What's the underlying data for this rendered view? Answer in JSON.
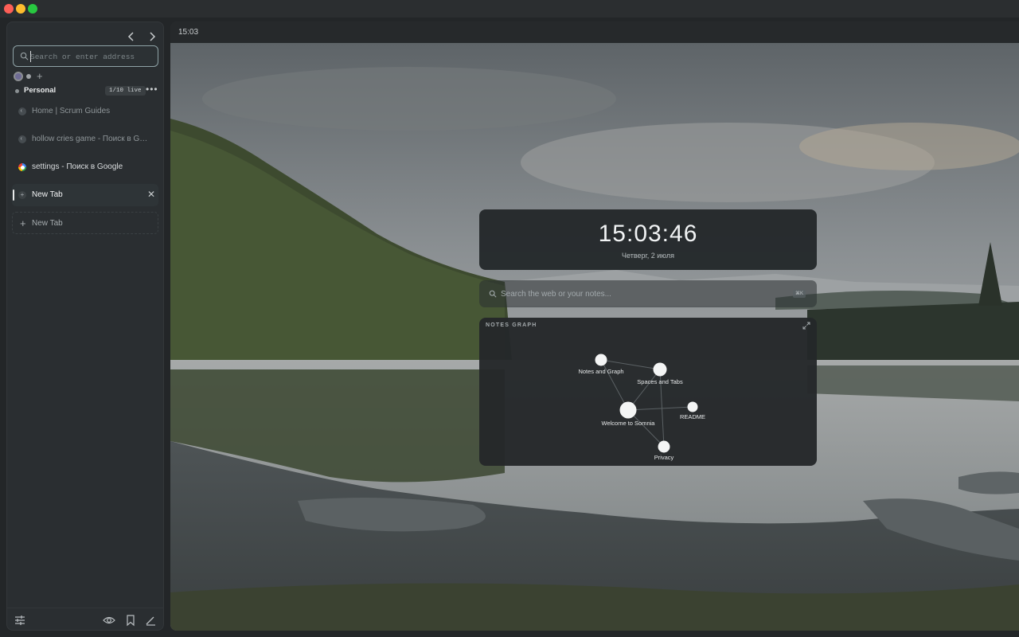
{
  "sidebar": {
    "url_placeholder": "Search or enter address",
    "space": {
      "name": "Personal",
      "badge": "1/10 live"
    },
    "tabs": [
      {
        "title": "Home | Scrum Guides",
        "favicon": "moon-icon"
      },
      {
        "title": "hollow cries game - Поиск в Google",
        "favicon": "moon-icon"
      },
      {
        "title": "settings - Поиск в Google",
        "favicon": "google-icon"
      },
      {
        "title": "New Tab",
        "favicon": "plus-icon",
        "active": true
      }
    ],
    "new_tab_label": "New Tab"
  },
  "content": {
    "top_time": "15:03",
    "clock": {
      "time": "15:03:46",
      "date": "Четверг, 2 июля"
    },
    "search": {
      "placeholder": "Search the web or your notes...",
      "shortcut": "⌘K"
    },
    "graph": {
      "title": "NOTES GRAPH",
      "nodes": [
        "Notes and Graph",
        "Spaces and Tabs",
        "Welcome to Somnia",
        "README",
        "Privacy"
      ]
    }
  },
  "colors": {
    "accent_border": "#8fa3a7",
    "sidebar_bg": "#2a2e31",
    "card_bg": "#222628"
  }
}
